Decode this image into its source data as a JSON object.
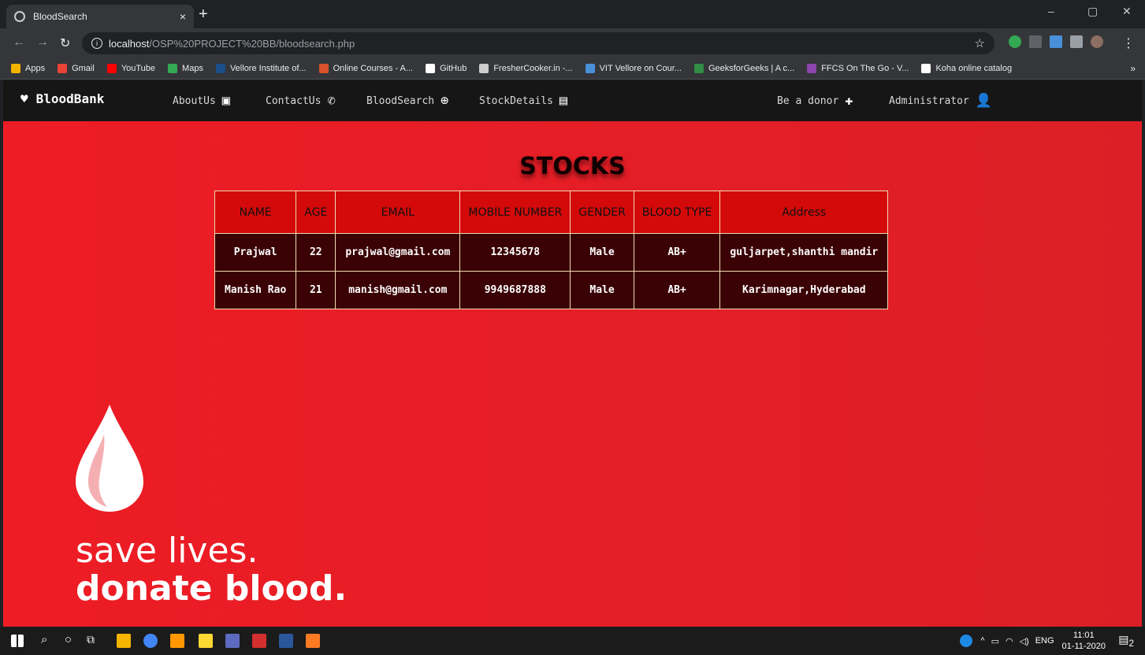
{
  "browser": {
    "tab_title": "BloodSearch",
    "tab_close": "×",
    "new_tab": "+",
    "url_host": "localhost",
    "url_path": "/OSP%20PROJECT%20BB/bloodsearch.php",
    "window_controls": [
      "–",
      "▢",
      "✕"
    ],
    "nav_icons": [
      "back-icon",
      "forward-icon",
      "reload-icon"
    ],
    "bookmarks": [
      {
        "label": "Apps",
        "color": "#f4b400"
      },
      {
        "label": "Gmail",
        "color": "#ea4335"
      },
      {
        "label": "YouTube",
        "color": "#ff0000"
      },
      {
        "label": "Maps",
        "color": "#34a853"
      },
      {
        "label": "Vellore Institute of...",
        "color": "#1a4e8a"
      },
      {
        "label": "Online Courses - A...",
        "color": "#d9532c"
      },
      {
        "label": "GitHub",
        "color": "#ffffff"
      },
      {
        "label": "FresherCooker.in -...",
        "color": "#cccccc"
      },
      {
        "label": "VIT Vellore on Cour...",
        "color": "#4a90d9"
      },
      {
        "label": "GeeksforGeeks | A c...",
        "color": "#2f8d46"
      },
      {
        "label": "FFCS On The Go - V...",
        "color": "#8e44ad"
      },
      {
        "label": "Koha online catalog",
        "color": "#ffffff"
      }
    ],
    "bookmarks_more": "»"
  },
  "site": {
    "brand": "BloodBank",
    "nav": {
      "about": "AboutUs",
      "contact": "ContactUs",
      "search": "BloodSearch",
      "stock": "StockDetails",
      "donor": "Be a donor",
      "admin": "Administrator"
    },
    "heading": "STOCKS",
    "table": {
      "headers": [
        "NAME",
        "AGE",
        "EMAIL",
        "MOBILE NUMBER",
        "GENDER",
        "BLOOD TYPE",
        "Address"
      ],
      "rows": [
        [
          "Prajwal",
          "22",
          "prajwal@gmail.com",
          "12345678",
          "Male",
          "AB+",
          "guljarpet,shanthi mandir"
        ],
        [
          "Manish Rao",
          "21",
          "manish@gmail.com",
          "9949687888",
          "Male",
          "AB+",
          "Karimnagar,Hyderabad"
        ]
      ]
    },
    "slogan": {
      "line1": "save lives.",
      "line2": "donate blood."
    },
    "colors": {
      "accent_red": "#ee1c25",
      "header_red": "#d40a0a",
      "row_dark": "#3a0205"
    }
  },
  "taskbar": {
    "language": "ENG",
    "time": "11:01",
    "date": "01-11-2020",
    "notification_count": "2"
  }
}
